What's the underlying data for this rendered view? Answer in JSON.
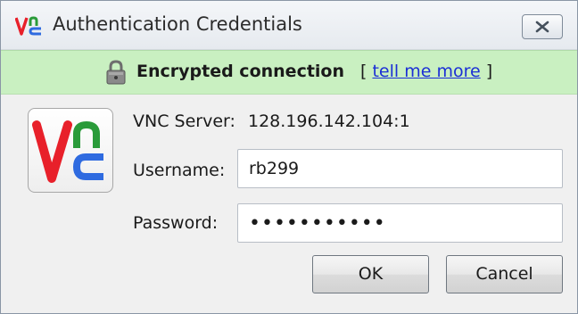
{
  "window": {
    "title": "Authentication Credentials",
    "close_icon": "close-icon"
  },
  "banner": {
    "icon": "lock-icon",
    "status": "Encrypted connection",
    "open_bracket": "[",
    "link_text": "tell me more",
    "close_bracket": "]",
    "background_color": "#c9f0c1"
  },
  "form": {
    "server_label": "VNC Server:",
    "server_value": "128.196.142.104:1",
    "username_label": "Username:",
    "username_value": "rb299",
    "password_label": "Password:",
    "password_value": "•••••••••••"
  },
  "buttons": {
    "ok_label": "OK",
    "cancel_label": "Cancel"
  },
  "colors": {
    "logo_red": "#e8202a",
    "logo_blue": "#2f6be0",
    "logo_green": "#2a9b3a",
    "link": "#1b2fd6"
  }
}
